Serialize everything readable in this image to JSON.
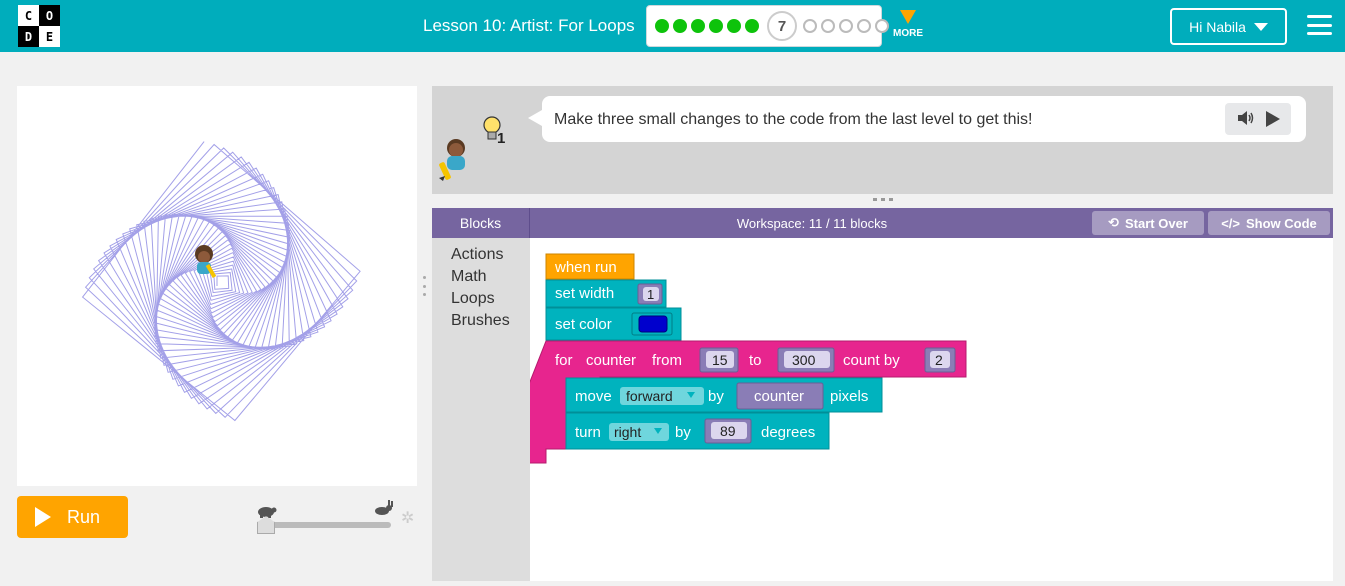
{
  "header": {
    "logo_letters": [
      "C",
      "O",
      "D",
      "E"
    ],
    "lesson_title": "Lesson 10: Artist: For Loops",
    "progress": {
      "completed": 6,
      "current_level": "7",
      "remaining": 5,
      "colors": {
        "done": "#0ec30b",
        "todo_border": "#bbbbbb"
      }
    },
    "more_label": "MORE",
    "user_label": "Hi Nabila",
    "menu_icon": "hamburger-icon",
    "background": "#00adbc"
  },
  "visualization": {
    "drawing": "spiral of rotating squares",
    "line_color": "#a3a0e8",
    "run_label": "Run",
    "run_color": "#ffa400",
    "speed_icons": {
      "slow": "turtle-icon",
      "fast": "rabbit-icon",
      "settings": "gear-icon"
    }
  },
  "instructions": {
    "text": "Make three small changes to the code from the last level to get this!",
    "hint_count": "1",
    "hint_icon": "lightbulb-icon",
    "audio_icons": [
      "speaker-icon",
      "play-icon"
    ]
  },
  "workspace": {
    "blocks_tab": "Blocks",
    "title": "Workspace: 11 / 11 blocks",
    "start_over": "Start Over",
    "show_code": "Show Code",
    "toolbox": [
      "Actions",
      "Math",
      "Loops",
      "Brushes"
    ],
    "program": {
      "when_run": "when run",
      "set_width": {
        "label": "set width",
        "value": "1"
      },
      "set_color": {
        "label": "set color",
        "value": "#0000cd"
      },
      "for_loop": {
        "for": "for",
        "variable": "counter",
        "from": "from",
        "from_value": "15",
        "to": "to",
        "to_value": "300",
        "count_by": "count by",
        "count_value": "2"
      },
      "move": {
        "label": "move",
        "direction": "forward",
        "by": "by",
        "value": "counter",
        "unit": "pixels"
      },
      "turn": {
        "label": "turn",
        "direction": "right",
        "by": "by",
        "value": "89",
        "unit": "degrees"
      }
    },
    "colors": {
      "event": "#ffa400",
      "action": "#00b3be",
      "loop": "#e7258e",
      "value": "#8a7db6",
      "header": "#7665a0"
    }
  }
}
